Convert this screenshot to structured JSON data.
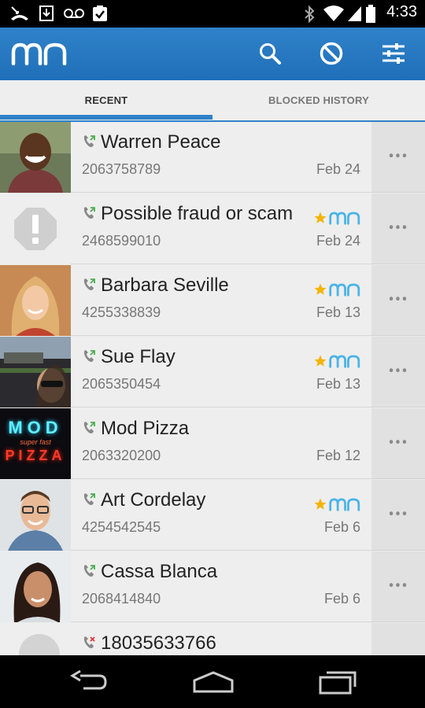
{
  "status_bar": {
    "time": "4:33"
  },
  "tabs": [
    {
      "label": "RECENT",
      "active": true
    },
    {
      "label": "BLOCKED HISTORY",
      "active": false
    }
  ],
  "colors": {
    "accent": "#2f82c9",
    "star": "#f4b400",
    "brand_light": "#4ab4e6",
    "missed": "#e53935"
  },
  "calls": [
    {
      "name": "Warren Peace",
      "number": "2063758789",
      "date": "Feb 24",
      "badge": false,
      "call_type": "outgoing"
    },
    {
      "name": "Possible fraud or scam",
      "number": "2468599010",
      "date": "Feb 24",
      "badge": true,
      "call_type": "outgoing"
    },
    {
      "name": "Barbara Seville",
      "number": "4255338839",
      "date": "Feb 13",
      "badge": true,
      "call_type": "outgoing"
    },
    {
      "name": "Sue Flay",
      "number": "2065350454",
      "date": "Feb 13",
      "badge": true,
      "call_type": "outgoing"
    },
    {
      "name": "Mod Pizza",
      "number": "2063320200",
      "date": "Feb 12",
      "badge": false,
      "call_type": "outgoing"
    },
    {
      "name": "Art Cordelay",
      "number": "4254542545",
      "date": "Feb 6",
      "badge": true,
      "call_type": "outgoing"
    },
    {
      "name": "Cassa Blanca",
      "number": "2068414840",
      "date": "Feb 6",
      "badge": false,
      "call_type": "outgoing"
    },
    {
      "name": "18035633766",
      "number": "",
      "date": "",
      "badge": false,
      "call_type": "missed"
    }
  ],
  "more_label": "•••",
  "neon_sign": [
    "MOD",
    "super fast",
    "PIZZA"
  ]
}
